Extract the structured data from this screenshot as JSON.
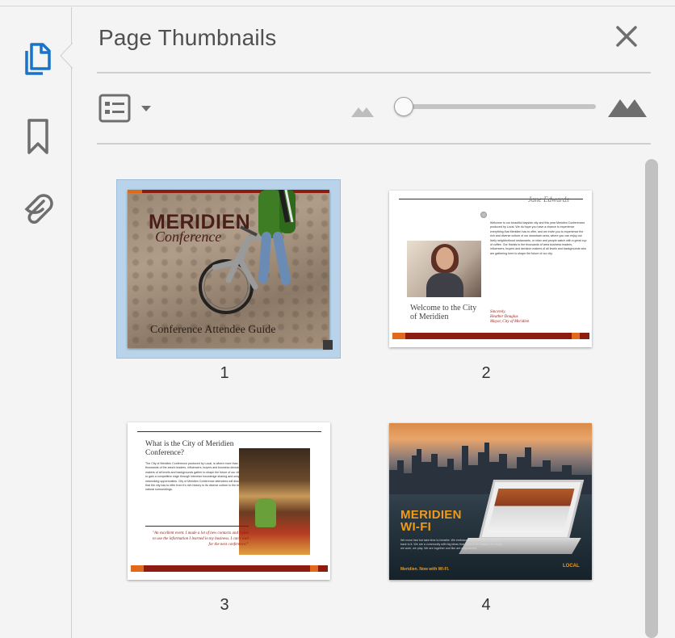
{
  "panel": {
    "title": "Page Thumbnails"
  },
  "sidebar": {
    "tools": [
      {
        "name": "page-thumbnails",
        "icon": "copy-pages-icon",
        "active": true
      },
      {
        "name": "bookmarks",
        "icon": "bookmark-icon",
        "active": false
      },
      {
        "name": "attachments",
        "icon": "paperclip-icon",
        "active": false
      }
    ]
  },
  "toolbar": {
    "options_icon": "options-list-icon",
    "zoom_level_fraction": 0.0,
    "small_icon": "mountain-small-icon",
    "large_icon": "mountain-large-icon"
  },
  "thumbnails": [
    {
      "number": "1",
      "selected": true,
      "brand": "MERIDIEN",
      "brand_sub": "Conference",
      "caption": "Conference Attendee Guide"
    },
    {
      "number": "2",
      "selected": false,
      "signature": "Jane Edwards",
      "welcome_line1": "Welcome to the City",
      "welcome_line2": "of Meridien",
      "body": "Welcome to our beautiful bayside city and this year Meridien Conferences produced by Local. We do hope you have a chance to experience everything that Meridien has to offer, and we invite you to experience the rich and diverse culture of our downtown area, where you can enjoy our lively neighborhood restaurants, or relax and people watch with a great cup of coffee. Our thanks to the thousands of area business leaders, influencers, buyers and decision makers of all levels and backgrounds who are gathering here to shape the future of our city.",
      "closing": "Sincerely,",
      "mayor_name": "Heather Douglas",
      "mayor_title": "Mayor, City of Meridien"
    },
    {
      "number": "3",
      "selected": false,
      "heading": "What is the City of Meridien Conference?",
      "body": "The City of Meridien Conference produced by Local, is where more than thousands of the area's leaders, influencers, buyers and business decision makers of all levels and backgrounds gather to shape the future of our city and to gain a competitive edge through intensive knowledge sharing and unique networking opportunities. City of Meridien Conference attendees will discover all that the city has to offer from it's rich history to its diverse culture to the beautiful natural surroundings.",
      "quote": "\"An excellent event. I made a lot of new contacts and I plan to use the information I learned in my business. I can't wait for the next conference!\""
    },
    {
      "number": "4",
      "selected": false,
      "title_line1": "MERIDIEN",
      "title_line2": "WI-FI",
      "body": "We move fast but take time to breathe. We embrace our environment and give back to it. We are a community with big ideas that need to be shared. We laugh, we work, we play. We are together and like are empowered.",
      "footer": "Meridien. Now with WI-FI.",
      "brand": "LOCAL"
    }
  ],
  "colors": {
    "accent_blue": "#1a73c8",
    "selection": "#b9d4ea",
    "brand_red": "#8c1b10",
    "brand_orange": "#e06a1a"
  }
}
